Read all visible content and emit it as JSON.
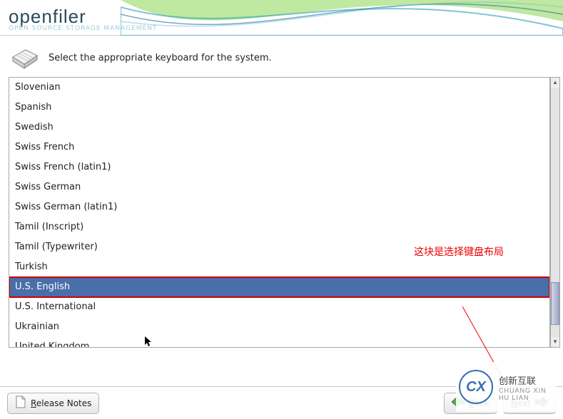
{
  "brand": {
    "name": "openfiler",
    "tagline": "OPEN SOURCE STORAGE MANAGEMENT"
  },
  "prompt": "Select the appropriate keyboard for the system.",
  "keyboard_list": {
    "items": [
      {
        "label": "Slovenian",
        "selected": false
      },
      {
        "label": "Spanish",
        "selected": false
      },
      {
        "label": "Swedish",
        "selected": false
      },
      {
        "label": "Swiss French",
        "selected": false
      },
      {
        "label": "Swiss French (latin1)",
        "selected": false
      },
      {
        "label": "Swiss German",
        "selected": false
      },
      {
        "label": "Swiss German (latin1)",
        "selected": false
      },
      {
        "label": "Tamil (Inscript)",
        "selected": false
      },
      {
        "label": "Tamil (Typewriter)",
        "selected": false
      },
      {
        "label": "Turkish",
        "selected": false
      },
      {
        "label": "U.S. English",
        "selected": true
      },
      {
        "label": "U.S. International",
        "selected": false
      },
      {
        "label": "Ukrainian",
        "selected": false
      },
      {
        "label": "United Kingdom",
        "selected": false
      }
    ]
  },
  "annotation": {
    "text": "这块是选择键盘布局"
  },
  "buttons": {
    "release_notes": "Release Notes",
    "back": "Back",
    "next": "Next"
  },
  "watermark": {
    "brand": "创新互联",
    "sub": "CHUANG XIN HU LIAN",
    "mark": "CX"
  }
}
